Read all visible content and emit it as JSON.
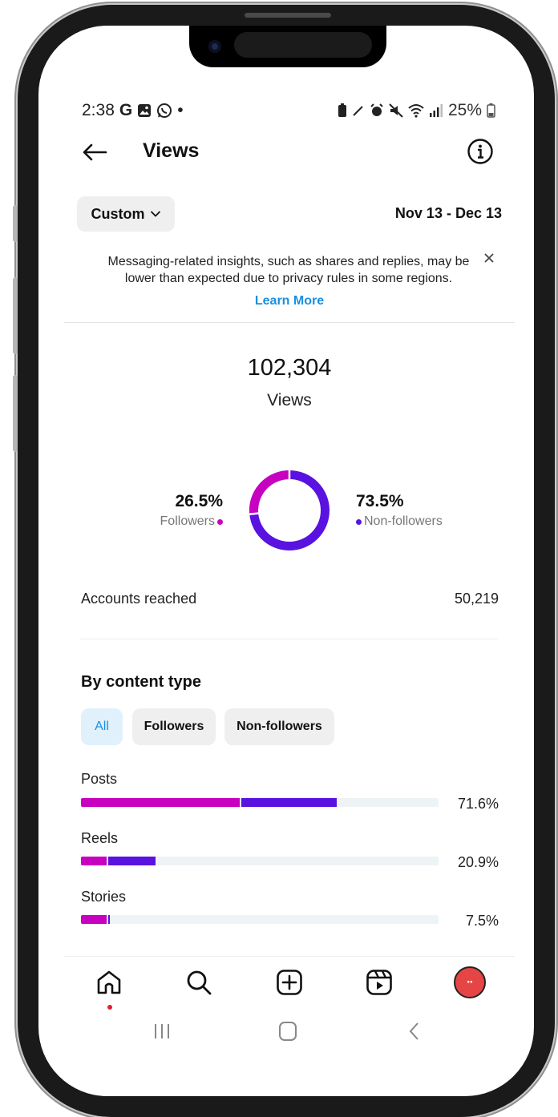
{
  "status_bar": {
    "time": "2:38",
    "left_icons": [
      "google-icon",
      "gallery-icon",
      "whatsapp-icon",
      "dot"
    ],
    "battery": "25%"
  },
  "header": {
    "title": "Views"
  },
  "filter": {
    "range_label": "Custom",
    "date_range": "Nov 13 - Dec 13"
  },
  "notice": {
    "text": "Messaging-related insights, such as shares and replies, may be lower than expected due to privacy rules in some regions.",
    "link": "Learn More"
  },
  "summary": {
    "total": "102,304",
    "total_label": "Views",
    "followers_pct": "26.5%",
    "followers_label": "Followers",
    "non_followers_pct": "73.5%",
    "non_followers_label": "Non-followers",
    "followers_fraction": 0.265
  },
  "accounts_reached": {
    "label": "Accounts reached",
    "value": "50,219"
  },
  "content_type": {
    "title": "By content type",
    "chips": [
      "All",
      "Followers",
      "Non-followers"
    ],
    "active_chip": "All",
    "rows": [
      {
        "label": "Posts",
        "percent": "71.6%",
        "followers_share": 0.445,
        "non_followers_share": 0.271
      },
      {
        "label": "Reels",
        "percent": "20.9%",
        "followers_share": 0.072,
        "non_followers_share": 0.137
      },
      {
        "label": "Stories",
        "percent": "7.5%",
        "followers_share": 0.072,
        "non_followers_share": 0.003
      }
    ]
  },
  "colors": {
    "followers": "#c800c0",
    "non_followers": "#5a12e0",
    "track": "#eef3f6",
    "link": "#1a8fe0"
  },
  "bottom_nav": {
    "items": [
      "home-icon",
      "search-icon",
      "create-icon",
      "reels-icon",
      "profile-avatar"
    ]
  }
}
